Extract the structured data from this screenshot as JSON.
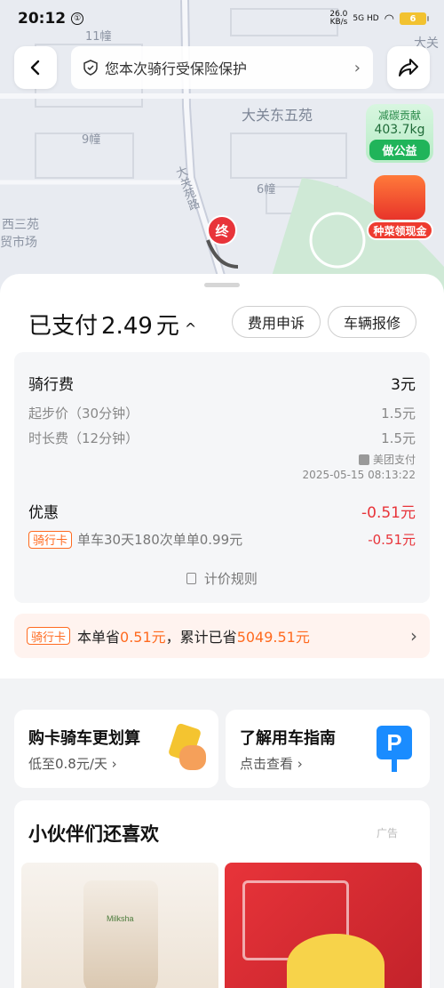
{
  "status": {
    "time": "20:12",
    "badge": "①",
    "speed_value": "26.0",
    "speed_unit": "KB/s",
    "network": "5G HD",
    "battery": "6"
  },
  "map": {
    "labels": [
      "11幢",
      "大关东五苑",
      "9幢",
      "6幢",
      "大关苑路",
      "西三苑",
      "贸市场",
      "大关"
    ],
    "end_marker": "终"
  },
  "header": {
    "back_icon": "back-arrow-icon",
    "share_icon": "share-icon",
    "insurance_text": "您本次骑行受保险保护",
    "insurance_chevron": "›"
  },
  "carbon": {
    "title": "减碳贡献",
    "value": "403.7kg",
    "action": "做公益"
  },
  "redpack": {
    "label": "种菜领现金"
  },
  "sheet": {
    "paid_label": "已支付",
    "paid_amount": "2.49",
    "paid_unit": "元",
    "caret": "^",
    "appeal_button": "费用申诉",
    "repair_button": "车辆报修"
  },
  "fees": {
    "ride_fee_label": "骑行费",
    "ride_fee_value": "3元",
    "base_label": "起步价（30分钟）",
    "base_value": "1.5元",
    "duration_label": "时长费（12分钟）",
    "duration_value": "1.5元",
    "pay_source": "美团支付",
    "pay_time": "2025-05-15 08:13:22",
    "discount_label": "优惠",
    "discount_value": "-0.51元",
    "card_tag": "骑行卡",
    "card_desc": "单车30天180次单单0.99元",
    "card_value": "-0.51元",
    "pricing_rule": "计价规则"
  },
  "savings": {
    "tag": "骑行卡",
    "prefix": "本单省",
    "order_saved": "0.51元",
    "middle": "，累计已省",
    "total_saved": "5049.51元",
    "chevron": "›"
  },
  "promos": [
    {
      "title": "购卡骑车更划算",
      "subtitle": "低至0.8元/天 ›"
    },
    {
      "title": "了解用车指南",
      "subtitle": "点击查看 ›"
    }
  ],
  "recommend": {
    "title": "小伙伴们还喜欢",
    "ad_label": "广告",
    "brand_text": "Milksha"
  },
  "colors": {
    "accent_red": "#e8343a",
    "accent_orange": "#ff6a1f",
    "green": "#20b45a"
  }
}
